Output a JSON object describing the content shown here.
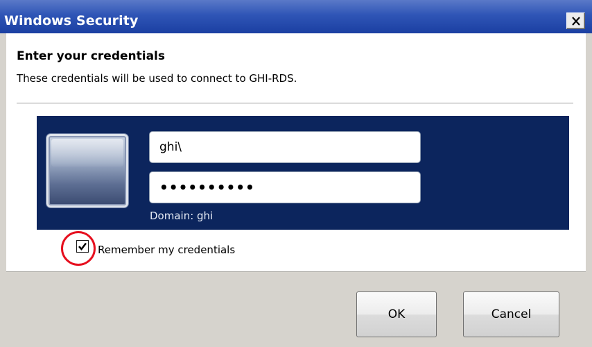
{
  "window": {
    "title": "Windows Security",
    "close_icon": "close-icon"
  },
  "prompt": {
    "heading": "Enter your credentials",
    "subtext": "These credentials will be used to connect to GHI-RDS."
  },
  "credentials": {
    "username_value": "ghi\\",
    "password_masked": "••••••••••",
    "domain_text": "Domain: ghi",
    "avatar_icon": "user-tile-icon"
  },
  "remember": {
    "label": "Remember my credentials",
    "checked": true
  },
  "buttons": {
    "ok_label": "OK",
    "cancel_label": "Cancel"
  },
  "colors": {
    "titlebar": "#2f55b6",
    "panel": "#0c255d",
    "highlight_circle": "#e60f1e"
  }
}
